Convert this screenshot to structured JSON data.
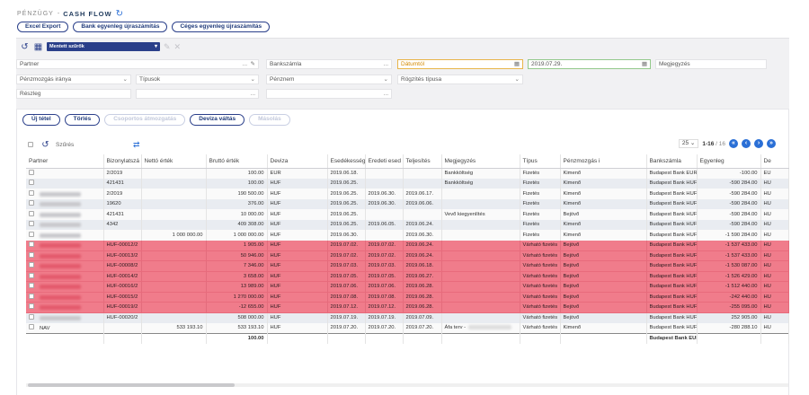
{
  "header": {
    "pre": "PÉNZÜGY",
    "sep": "-",
    "title": "CASH FLOW",
    "buttons": [
      "Excel Export",
      "Bank egyenleg újraszámítás",
      "Céges egyenleg újraszámítás"
    ]
  },
  "filters": {
    "saved_filters_label": "Mentett szűrők",
    "partner": "Partner",
    "bankszamla": "Bankszámla",
    "datumtol": "Dátumtól",
    "datumig": "2019.07.29.",
    "megjegyzes": "Megjegyzés",
    "penzmozgas": "Pénzmozgás iránya",
    "tipusok": "Típusok",
    "penznem": "Pénznem",
    "rogzites": "Rögzítés típusa",
    "reszleg": "Részleg",
    "ellipsis": "...",
    "chevron": "⌄"
  },
  "actions": {
    "new": "Új tétel",
    "delete": "Törlés",
    "group": "Csoportos átmozgatás",
    "currency": "Deviza váltás",
    "copy": "Másolás"
  },
  "search": {
    "placeholder": "Szűrés"
  },
  "pager": {
    "size": "25",
    "range": "1-16",
    "total": "/ 16"
  },
  "table": {
    "headers": [
      "Partner",
      "Bizonylatszá",
      "Nettó érték",
      "Bruttó érték",
      "Deviza",
      "Esedékesség",
      "Eredeti esed",
      "Teljesítés",
      "Megjegyzés",
      "Típus",
      "Pénzmozgás i",
      "Bankszámla",
      "Egyenleg",
      "De"
    ],
    "rows": [
      {
        "style": "odd",
        "blur": false,
        "partner": "",
        "biz": "2/2019",
        "netto": "",
        "brutto": "100.00",
        "deviza": "EUR",
        "esed": "2019.06.18.",
        "ered": "",
        "telj": "",
        "megj": "Bankköltség",
        "tipus": "Fizetés",
        "penzm": "Kimenő",
        "bank": "Budapest Bank EUR",
        "egy": "-100.00",
        "de": "EU"
      },
      {
        "style": "even",
        "blur": false,
        "partner": "",
        "biz": "421431",
        "netto": "",
        "brutto": "100.00",
        "deviza": "HUF",
        "esed": "2019.06.25.",
        "ered": "",
        "telj": "",
        "megj": "Bankköltség",
        "tipus": "Fizetés",
        "penzm": "Kimenő",
        "bank": "Budapest Bank HUF",
        "egy": "-590 284.00",
        "de": "HU"
      },
      {
        "style": "odd",
        "blur": true,
        "partner": "",
        "biz": "2/2019",
        "netto": "",
        "brutto": "190 500.00",
        "deviza": "HUF",
        "esed": "2019.06.25.",
        "ered": "2019.06.30.",
        "telj": "2019.06.17.",
        "megj": "",
        "tipus": "Fizetés",
        "penzm": "Kimenő",
        "bank": "Budapest Bank HUF",
        "egy": "-590 284.00",
        "de": "HU"
      },
      {
        "style": "even",
        "blur": true,
        "partner": "",
        "biz": "19620",
        "netto": "",
        "brutto": "376.00",
        "deviza": "HUF",
        "esed": "2019.06.25.",
        "ered": "2019.06.30.",
        "telj": "2019.06.06.",
        "megj": "",
        "tipus": "Fizetés",
        "penzm": "Kimenő",
        "bank": "Budapest Bank HUF",
        "egy": "-590 284.00",
        "de": "HU"
      },
      {
        "style": "odd",
        "blur": true,
        "partner": "",
        "biz": "421431",
        "netto": "",
        "brutto": "10 000.00",
        "deviza": "HUF",
        "esed": "2019.06.25.",
        "ered": "",
        "telj": "",
        "megj": "Vevő kiegyenlítés",
        "tipus": "Fizetés",
        "penzm": "Bejövő",
        "bank": "Budapest Bank HUF",
        "egy": "-590 284.00",
        "de": "HU"
      },
      {
        "style": "even",
        "blur": true,
        "partner": "",
        "biz": "4342",
        "netto": "",
        "brutto": "409 308.00",
        "deviza": "HUF",
        "esed": "2019.06.25.",
        "ered": "2019.06.05.",
        "telj": "2019.06.24.",
        "megj": "",
        "tipus": "Fizetés",
        "penzm": "Kimenő",
        "bank": "Budapest Bank HUF",
        "egy": "-590 284.00",
        "de": "HU"
      },
      {
        "style": "odd",
        "blur": true,
        "partner": "",
        "biz": "",
        "netto": "1 000 000.00",
        "brutto": "1 000 000.00",
        "deviza": "HUF",
        "esed": "2019.06.30.",
        "ered": "",
        "telj": "2019.06.30.",
        "megj": "",
        "tipus": "Fizetés",
        "penzm": "Kimenő",
        "bank": "Budapest Bank HUF",
        "egy": "-1 590 284.00",
        "de": "HU"
      },
      {
        "style": "red",
        "blur": true,
        "partner": "",
        "biz": "HUF-00012/2",
        "netto": "",
        "brutto": "1 905.00",
        "deviza": "HUF",
        "esed": "2019.07.02.",
        "ered": "2019.07.02.",
        "telj": "2019.06.24.",
        "megj": "",
        "tipus": "Várható fizetés",
        "penzm": "Bejövő",
        "bank": "Budapest Bank HUF",
        "egy": "-1 537 433.00",
        "de": "HU"
      },
      {
        "style": "red",
        "blur": true,
        "partner": "",
        "biz": "HUF-00013/2",
        "netto": "",
        "brutto": "50 946.00",
        "deviza": "HUF",
        "esed": "2019.07.02.",
        "ered": "2019.07.02.",
        "telj": "2019.06.24.",
        "megj": "",
        "tipus": "Várható fizetés",
        "penzm": "Bejövő",
        "bank": "Budapest Bank HUF",
        "egy": "-1 537 433.00",
        "de": "HU"
      },
      {
        "style": "red",
        "blur": true,
        "partner": "",
        "biz": "HUF-00008/2",
        "netto": "",
        "brutto": "7 346.00",
        "deviza": "HUF",
        "esed": "2019.07.03.",
        "ered": "2019.07.03.",
        "telj": "2019.06.18.",
        "megj": "",
        "tipus": "Várható fizetés",
        "penzm": "Bejövő",
        "bank": "Budapest Bank HUF",
        "egy": "-1 530 087.00",
        "de": "HU"
      },
      {
        "style": "red",
        "blur": true,
        "partner": "",
        "biz": "HUF-00014/2",
        "netto": "",
        "brutto": "3 658.00",
        "deviza": "HUF",
        "esed": "2019.07.05.",
        "ered": "2019.07.05.",
        "telj": "2019.06.27.",
        "megj": "",
        "tipus": "Várható fizetés",
        "penzm": "Bejövő",
        "bank": "Budapest Bank HUF",
        "egy": "-1 526 429.00",
        "de": "HU"
      },
      {
        "style": "red",
        "blur": true,
        "partner": "",
        "biz": "HUF-00016/2",
        "netto": "",
        "brutto": "13 989.00",
        "deviza": "HUF",
        "esed": "2019.07.06.",
        "ered": "2019.07.06.",
        "telj": "2019.06.28.",
        "megj": "",
        "tipus": "Várható fizetés",
        "penzm": "Bejövő",
        "bank": "Budapest Bank HUF",
        "egy": "-1 512 440.00",
        "de": "HU"
      },
      {
        "style": "red",
        "blur": true,
        "partner": "",
        "biz": "HUF-00015/2",
        "netto": "",
        "brutto": "1 270 000.00",
        "deviza": "HUF",
        "esed": "2019.07.08.",
        "ered": "2019.07.08.",
        "telj": "2019.06.28.",
        "megj": "",
        "tipus": "Várható fizetés",
        "penzm": "Bejövő",
        "bank": "Budapest Bank HUF",
        "egy": "-242 440.00",
        "de": "HU"
      },
      {
        "style": "red",
        "blur": true,
        "partner": "",
        "biz": "HUF-00019/2",
        "netto": "",
        "brutto": "-12 655.00",
        "deviza": "HUF",
        "esed": "2019.07.12.",
        "ered": "2019.07.12.",
        "telj": "2019.06.28.",
        "megj": "",
        "tipus": "Várható fizetés",
        "penzm": "Bejövő",
        "bank": "Budapest Bank HUF",
        "egy": "-255 095.00",
        "de": "HU"
      },
      {
        "style": "even",
        "blur": true,
        "partner": "",
        "biz": "HUF-00020/2",
        "netto": "",
        "brutto": "508 000.00",
        "deviza": "HUF",
        "esed": "2019.07.19.",
        "ered": "2019.07.19.",
        "telj": "2019.07.09.",
        "megj": "",
        "tipus": "Várható fizetés",
        "penzm": "Bejövő",
        "bank": "Budapest Bank HUF",
        "egy": "252 905.00",
        "de": "HU"
      },
      {
        "style": "odd",
        "blur": false,
        "partner": "NAV",
        "biz": "",
        "netto": "533 193.10",
        "brutto": "533 193.10",
        "deviza": "HUF",
        "esed": "2019.07.20.",
        "ered": "2019.07.20.",
        "telj": "2019.07.20.",
        "megj": "Áfa terv -",
        "tipus": "Várható fizetés",
        "penzm": "Kimenő",
        "bank": "Budapest Bank HUF",
        "egy": "-280 288.10",
        "de": "HU"
      }
    ],
    "sum": {
      "brutto": "100.00",
      "bank": "Budapest Bank EUR"
    }
  },
  "colors": {
    "accent": "#2a3f8a",
    "highlight_row": "#f07c8b",
    "link_blue": "#2a6fd6"
  }
}
